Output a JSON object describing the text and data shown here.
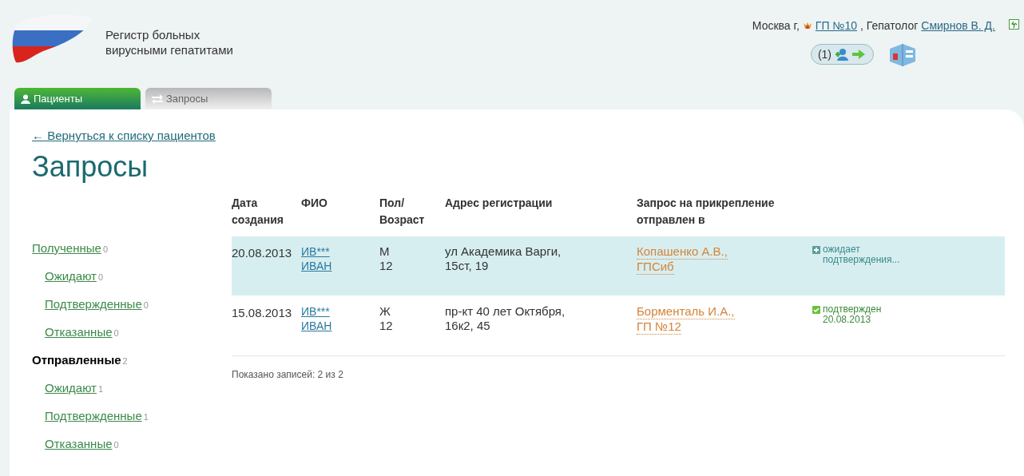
{
  "header": {
    "app_title": "Регистр больных вирусными гепатитами",
    "location": "Москва г,",
    "clinic": "ГП №10",
    "separator": ",",
    "role": "Гепатолог",
    "user": "Смирнов В. Д.",
    "counter": "(1)"
  },
  "tabs": [
    {
      "label": "Пациенты",
      "selected": true
    },
    {
      "label": "Запросы",
      "selected": false
    }
  ],
  "back_link": "← Вернуться к списку пациентов",
  "page_title": "Запросы",
  "sidebar": {
    "items": [
      {
        "label": "Полученные",
        "count": "0",
        "selected": false,
        "children": [
          {
            "label": "Ожидают",
            "count": "0",
            "selected": false
          },
          {
            "label": "Подтвержденные",
            "count": "0",
            "selected": false
          },
          {
            "label": "Отказанные",
            "count": "0",
            "selected": false
          }
        ]
      },
      {
        "label": "Отправленные",
        "count": "2",
        "selected": true,
        "children": [
          {
            "label": "Ожидают",
            "count": "1",
            "selected": false
          },
          {
            "label": "Подтвержденные",
            "count": "1",
            "selected": false
          },
          {
            "label": "Отказанные",
            "count": "0",
            "selected": false
          }
        ]
      }
    ]
  },
  "table": {
    "columns": [
      "Дата создания",
      "ФИО",
      "Пол/ Возраст",
      "Адрес регистрации",
      "Запрос на прикрепление отправлен в"
    ],
    "rows": [
      {
        "selected": true,
        "date": "20.08.2013",
        "name_1": "ИВ***",
        "name_2": "ИВАН",
        "sex": "М",
        "age": "12",
        "address": "ул Академика Варги, 15ст, 19",
        "recipient_1": "Копашенко А.В.,",
        "recipient_2": "ГПСиб",
        "status": {
          "kind": "pending",
          "line_1": "ожидает",
          "line_2": "подтверждения..."
        }
      },
      {
        "selected": false,
        "date": "15.08.2013",
        "name_1": "ИВ***",
        "name_2": "ИВАН",
        "sex": "Ж",
        "age": "12",
        "address": "пр-кт 40 лет Октября, 16к2, 45",
        "recipient_1": "Борменталь И.А.,",
        "recipient_2": "ГП №12",
        "status": {
          "kind": "confirmed",
          "line_1": "подтвержден",
          "line_2": "20.08.2013"
        }
      }
    ],
    "footer": "Показано записей: 2 из 2"
  }
}
